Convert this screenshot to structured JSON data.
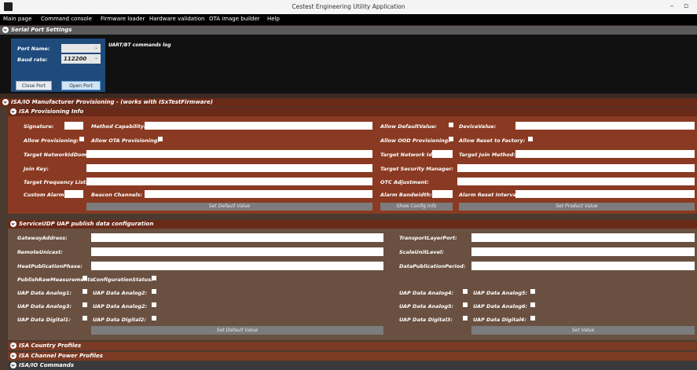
{
  "window": {
    "title": "Cestest Engineering Utility Application",
    "minimize": "–",
    "maximize": "▫"
  },
  "menu": [
    "Main page",
    "Command console",
    "Firmware loader",
    "Hardware validation",
    "OTA image builder",
    "Help"
  ],
  "serial": {
    "header": "Serial Port Settings",
    "port_label": "Port Name:",
    "port_value": "",
    "baud_label": "Baud rate:",
    "baud_value": "112200",
    "log_title": "UART/BT commands log",
    "close_btn": "Close Port",
    "open_btn": "Open Port"
  },
  "isa": {
    "header": "ISA/IO Manufacturer Provisioning - (works with ISxTestFirmware)",
    "prov_header": "ISA Provisioning Info",
    "row1": {
      "sig": "Signature:",
      "method": "Method Capability:",
      "allow_default": "Allow DefaultValue:",
      "device_id": "DeviceValue:"
    },
    "row2": {
      "allow_prov": "Allow Provisioning:",
      "allow_ota": "Allow OTA Provisioning:",
      "allow_ood": "Allow OOD Provisioning:",
      "allow_reset": "Allow Reset to Factory:"
    },
    "row3": {
      "network": "Target NetworkIdDomain:",
      "target_net": "Target Network Id:",
      "target_join": "Target Join Method:"
    },
    "row4": {
      "key": "Join Key:",
      "security": "Target Security Manager:"
    },
    "row5": {
      "freq": "Target Frequency List:",
      "otc": "OTC Adjustment:"
    },
    "row6": {
      "custom": "Custom Alarm:",
      "reports": "Beacon Channels:",
      "alarm": "Alarm Bandwidth:",
      "reset_cmd": "Alarm Reset Interval:"
    },
    "btn_default": "Set Default Value",
    "btn_load": "Show Config Info",
    "btn_product": "Set Product Value"
  },
  "udp": {
    "header": "ServiceUDP UAP publish data configuration",
    "gateway": "GatewayAddress:",
    "remote_unicast": "RemoteUnicast:",
    "publication": "HeatPublicationPhase:",
    "transport": "TransportLayerPort:",
    "scale": "ScaleUnitLevel:",
    "data_period": "DataPublicationPeriod:",
    "publish_raw": "PublishRawMeasurements:",
    "config_status": "ConfigurationStatus:",
    "analog": [
      "UAP Data Analog1:",
      "UAP Data Analog2:",
      "UAP Data Analog3:",
      "UAP Data Analog4:",
      "UAP Data Analog5:",
      "UAP Data Analog6:"
    ],
    "digital": [
      "UAP Data Digital1:",
      "UAP Data Digital2:",
      "UAP Data Digital3:",
      "UAP Data Digital4:"
    ],
    "btn_default": "Set Default Value",
    "btn_set": "Set Value"
  },
  "collapsed": [
    "ISA Country Profiles",
    "ISA Channel Power Profiles",
    "ISA/IO Commands"
  ]
}
